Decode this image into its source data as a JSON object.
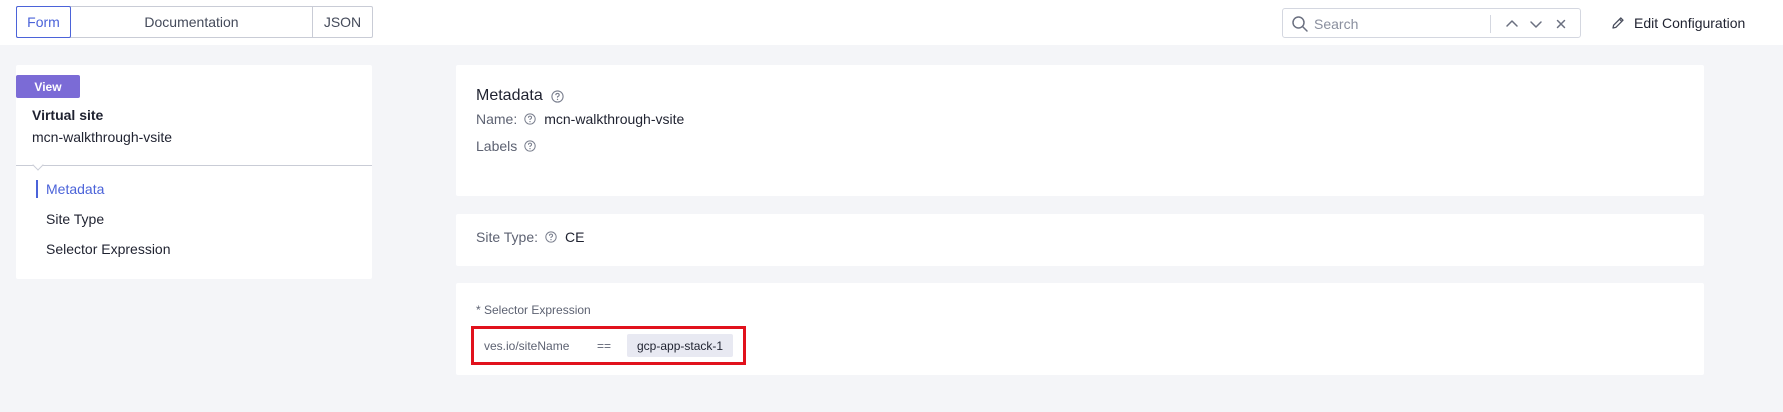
{
  "tabs": [
    {
      "label": "Form",
      "active": true
    },
    {
      "label": "Documentation",
      "active": false
    },
    {
      "label": "JSON",
      "active": false
    }
  ],
  "search": {
    "placeholder": "Search",
    "value": ""
  },
  "toolbar": {
    "edit_label": "Edit Configuration"
  },
  "left": {
    "badge": "View",
    "title": "Virtual site",
    "name": "mcn-walkthrough-vsite",
    "toc": [
      "Metadata",
      "Site Type",
      "Selector Expression"
    ],
    "toc_active": "Metadata"
  },
  "metadata": {
    "title": "Metadata",
    "name_label": "Name:",
    "name_value": "mcn-walkthrough-vsite",
    "labels_label": "Labels"
  },
  "site_type": {
    "label": "Site Type:",
    "value": "CE"
  },
  "selector": {
    "label": "* Selector Expression",
    "key": "ves.io/siteName",
    "operator": "==",
    "value": "gcp-app-stack-1"
  },
  "colors": {
    "accent": "#4b63d9",
    "badge": "#7b6bd6",
    "highlight": "#e1111c"
  }
}
